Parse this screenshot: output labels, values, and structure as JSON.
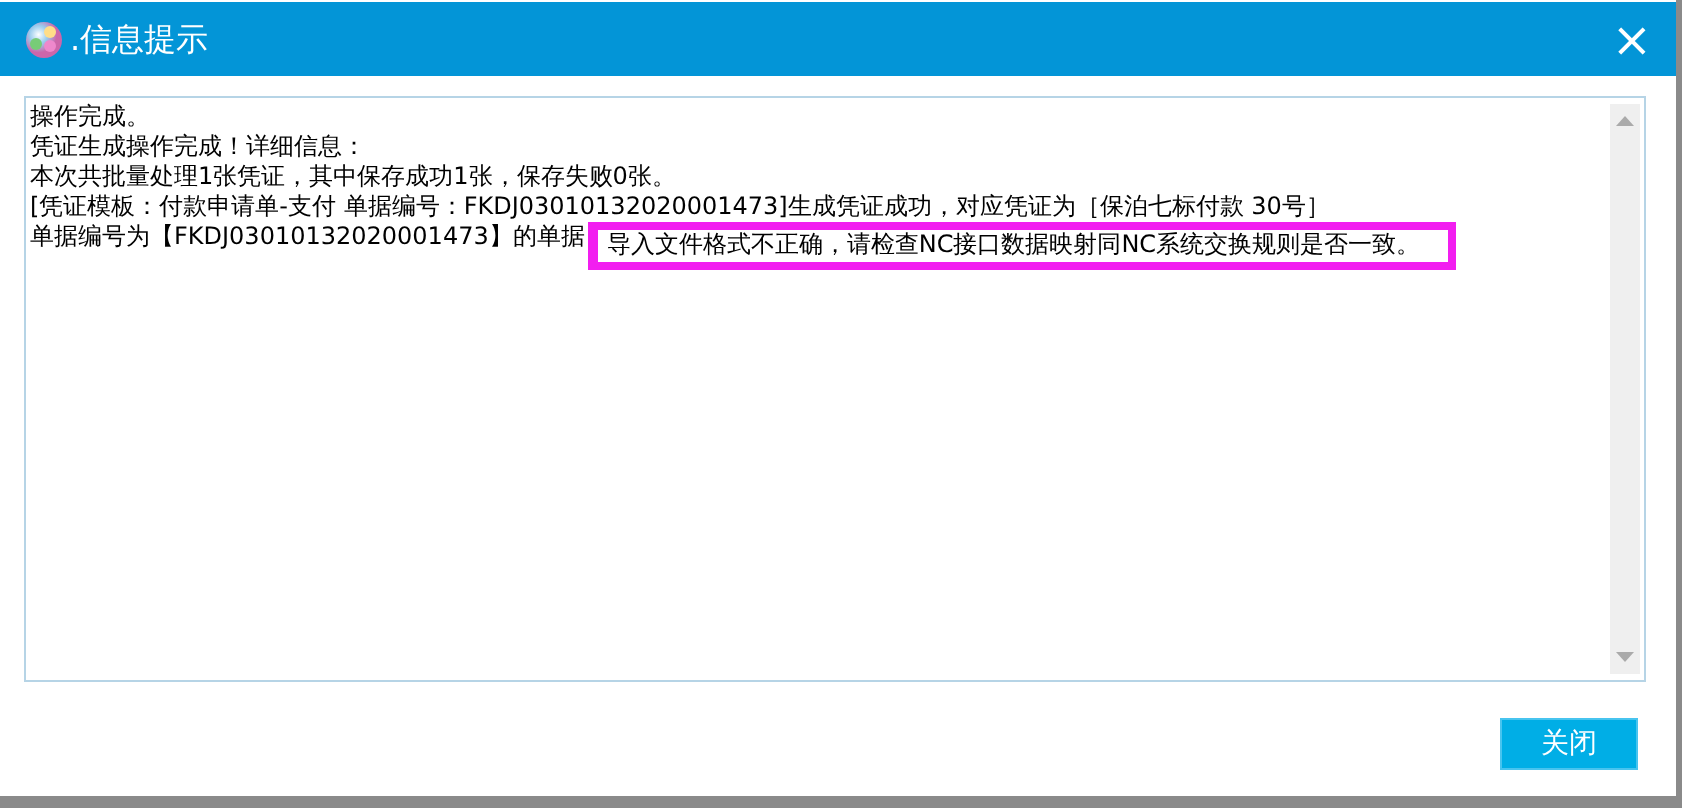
{
  "window": {
    "title": ".信息提示",
    "close": "×"
  },
  "message": {
    "lines": [
      {
        "text": "操作完成。"
      },
      {
        "text": "凭证生成操作完成！详细信息："
      },
      {
        "text": "本次共批量处理1张凭证，其中保存成功1张，保存失败0张。"
      },
      {
        "text": "[凭证模板：付款申请单-支付 单据编号：FKDJ03010132020001473]生成凭证成功，对应凭证为［保泊七标付款 30号］"
      },
      {
        "text": "单据编号为【FKDJ03010132020001473】的单据",
        "highlight": "导入文件格式不正确，请检查NC接口数据映射同NC系统交换规则是否一致。"
      }
    ]
  },
  "buttons": [
    {
      "label": "关闭"
    }
  ]
}
